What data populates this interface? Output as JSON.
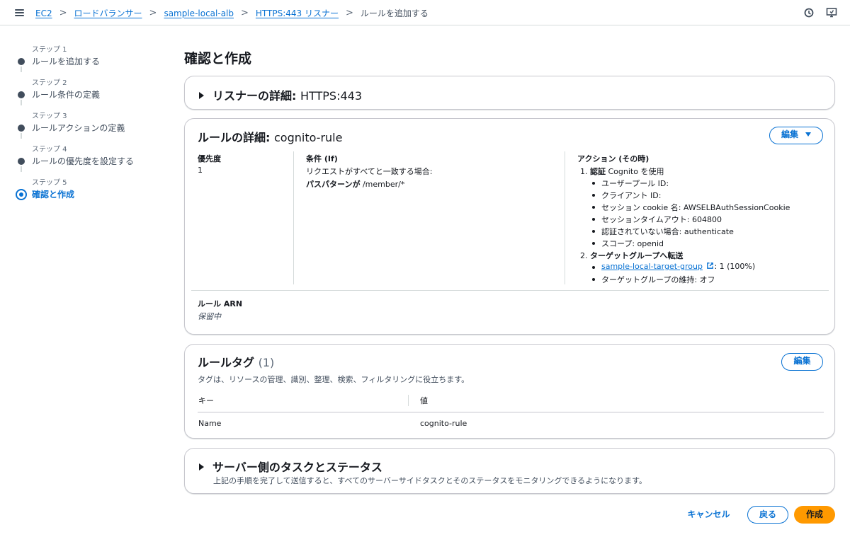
{
  "breadcrumb": {
    "items": [
      "EC2",
      "ロードバランサー",
      "sample-local-alb",
      "HTTPS:443 リスナー"
    ],
    "current": "ルールを追加する",
    "separator": ">"
  },
  "steps": [
    {
      "num": "ステップ 1",
      "label": "ルールを追加する"
    },
    {
      "num": "ステップ 2",
      "label": "ルール条件の定義"
    },
    {
      "num": "ステップ 3",
      "label": "ルールアクションの定義"
    },
    {
      "num": "ステップ 4",
      "label": "ルールの優先度を設定する"
    },
    {
      "num": "ステップ 5",
      "label": "確認と作成"
    }
  ],
  "page_title": "確認と作成",
  "listener_section": {
    "title_bold": "リスナーの詳細:",
    "title_value": "HTTPS:443"
  },
  "rule_section": {
    "title_bold": "ルールの詳細:",
    "title_value": "cognito-rule",
    "edit_label": "編集",
    "priority_label": "優先度",
    "priority_value": "1",
    "condition_label": "条件 (If)",
    "condition_text": "リクエストがすべてと一致する場合:",
    "condition_bold": "パスパターンが",
    "condition_value": "/member/*",
    "action_label": "アクション (その時)",
    "action1_prefix": "1.",
    "action1_bold": "認証",
    "action1_text": "Cognito を使用",
    "action1_items": [
      "ユーザープール ID:",
      "クライアント ID:",
      "セッション cookie 名: AWSELBAuthSessionCookie",
      "セッションタイムアウト: 604800",
      "認証されていない場合: authenticate",
      "スコープ: openid"
    ],
    "action2_prefix": "2.",
    "action2_bold": "ターゲットグループへ転送",
    "action2_link": "sample-local-target-group",
    "action2_link_suffix": ": 1 (100%)",
    "action2_item2": "ターゲットグループの維持: オフ",
    "arn_label": "ルール ARN",
    "arn_value": "保留中"
  },
  "tags_section": {
    "title": "ルールタグ",
    "count": "(1)",
    "edit_label": "編集",
    "description": "タグは、リソースの管理、識別、整理、検索、フィルタリングに役立ちます。",
    "col_key": "キー",
    "col_value": "値",
    "rows": [
      {
        "key": "Name",
        "value": "cognito-rule"
      }
    ]
  },
  "server_section": {
    "title": "サーバー側のタスクとステータス",
    "description": "上記の手順を完了して送信すると、すべてのサーバーサイドタスクとそのステータスをモニタリングできるようになります。"
  },
  "footer": {
    "cancel": "キャンセル",
    "back": "戻る",
    "create": "作成"
  },
  "colors": {
    "accent": "#0972d3",
    "primary_button": "#ff9900",
    "text": "#16191f",
    "border": "#c6c6cd"
  },
  "icons": [
    "menu-icon",
    "notifications-icon",
    "display-settings-icon",
    "caret-right-icon",
    "caret-down-icon",
    "external-link-icon"
  ]
}
